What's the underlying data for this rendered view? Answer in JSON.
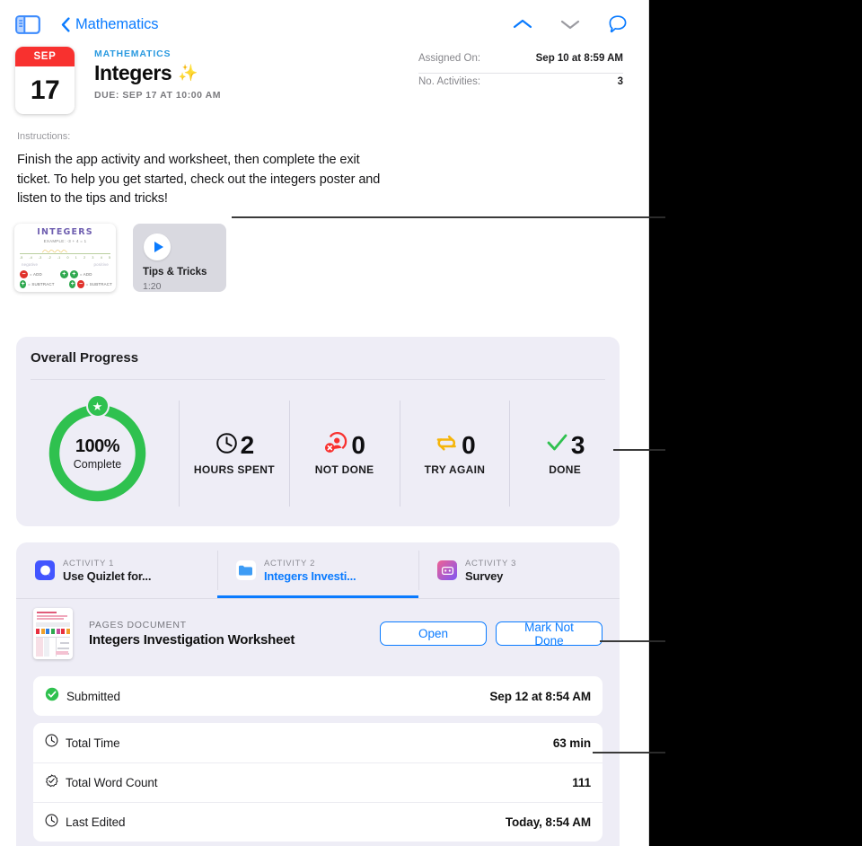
{
  "nav": {
    "sidebar_toggle_icon": "sidebar-toggle-icon",
    "back_label": "Mathematics",
    "back_icon": "chevron-left-icon",
    "up_icon": "chevron-up-icon",
    "down_icon": "chevron-down-icon",
    "comment_icon": "comment-bubble-icon"
  },
  "header": {
    "calendar": {
      "month": "SEP",
      "day": "17"
    },
    "course": "MATHEMATICS",
    "title": "Integers",
    "sparkle": "✨",
    "due": "DUE: SEP 17 AT 10:00 AM",
    "meta": [
      {
        "key": "Assigned On:",
        "value": "Sep 10 at 8:59 AM"
      },
      {
        "key": "No. Activities:",
        "value": "3"
      }
    ]
  },
  "instructions": {
    "label": "Instructions:",
    "body": "Finish the app activity and worksheet, then complete the exit ticket. To help you get started, check out the integers poster and listen to the tips and tricks!"
  },
  "attachments": {
    "poster": {
      "title": "INTEGERS",
      "subtitle": "EXAMPLE:  -3 + 4 = 1",
      "tick_labels": [
        "-5",
        "-4",
        "-3",
        "-2",
        "-1",
        "0",
        "1",
        "2",
        "3",
        "4",
        "5"
      ],
      "left_word": "negative",
      "right_word": "positive",
      "rules": [
        {
          "sign1": "−",
          "sign1_color": "red",
          "text1": "= ADD",
          "sign2": "+",
          "sign2_color": "green",
          "sign3": "+",
          "sign3_color": "green",
          "text2": "= ADD"
        },
        {
          "sign1": "+",
          "sign1_color": "green",
          "text1": "= SUBTRACT",
          "sign2": "+",
          "sign2_color": "green",
          "sign3": "−",
          "sign3_color": "red",
          "text2": "= SUBTRACT"
        }
      ]
    },
    "video": {
      "play_icon": "play-icon",
      "title": "Tips & Tricks",
      "duration": "1:20"
    }
  },
  "progress": {
    "title": "Overall Progress",
    "ring": {
      "percent": 100,
      "percent_label": "100%",
      "caption": "Complete",
      "color": "#2fc14f",
      "badge_icon": "star-icon"
    },
    "stats": [
      {
        "icon": "clock-icon",
        "value": "2",
        "label": "HOURS SPENT",
        "color": "#0e0e10"
      },
      {
        "icon": "person-x-icon",
        "value": "0",
        "label": "NOT DONE",
        "color": "#f8312f"
      },
      {
        "icon": "try-again-icon",
        "value": "0",
        "label": "TRY AGAIN",
        "color": "#f5b50a"
      },
      {
        "icon": "checkmark-icon",
        "value": "3",
        "label": "DONE",
        "color": "#2fc14f"
      }
    ]
  },
  "activities": {
    "tabs": [
      {
        "kicker": "ACTIVITY 1",
        "name": "Use Quizlet for...",
        "icon": "quizlet-app-icon",
        "active": false
      },
      {
        "kicker": "ACTIVITY 2",
        "name": "Integers Investi...",
        "icon": "folder-icon",
        "active": true
      },
      {
        "kicker": "ACTIVITY 3",
        "name": "Survey",
        "icon": "survey-app-icon",
        "active": false
      }
    ],
    "document": {
      "kicker": "PAGES DOCUMENT",
      "name": "Integers Investigation Worksheet",
      "thumbnail_icon": "pages-document-thumbnail",
      "open_label": "Open",
      "mark_not_done_label": "Mark Not Done"
    },
    "submitted": {
      "icon": "check-circle-icon",
      "label": "Submitted",
      "value": "Sep 12 at 8:54 AM"
    },
    "details": [
      {
        "icon": "clock-icon",
        "label": "Total Time",
        "value": "63 min"
      },
      {
        "icon": "badge-check-icon",
        "label": "Total Word Count",
        "value": "111"
      },
      {
        "icon": "clock-icon",
        "label": "Last Edited",
        "value": "Today, 8:54 AM"
      }
    ]
  },
  "colors": {
    "accent": "#0a7bff",
    "green": "#2fc14f",
    "red": "#f8312f",
    "yellow": "#f5b50a",
    "card_bg": "#eeedf6"
  }
}
